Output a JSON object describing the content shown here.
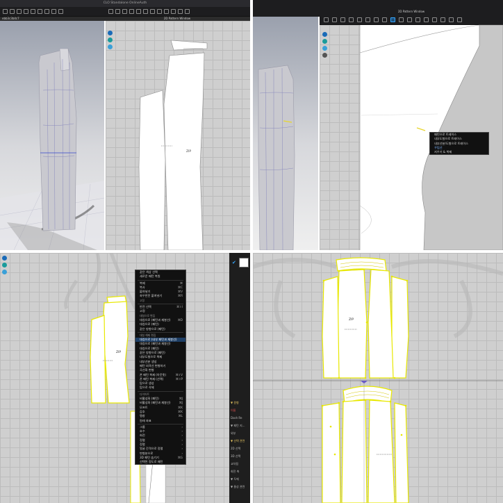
{
  "q1": {
    "window_title": "CLO Standalone OnlineAuth",
    "left_tab": "ebb3c3b4c7",
    "panel_2d_title": "2D Pattern Window",
    "zip_label": "ZIP"
  },
  "q2": {
    "panel_2d_title": "2D Pattern Window",
    "context_menu": [
      "패턴으로 트레이스",
      "내부도형으로 트레이스",
      "내부선분/도형으로 트레이스",
      "꾸밈선",
      "지우기 & 복제"
    ]
  },
  "q3": {
    "zip_label": "ZIP",
    "context_menu": [
      {
        "label": "같은 색상 선택",
        "sc": ""
      },
      {
        "label": "새로운 패턴 복원",
        "sc": ""
      },
      {
        "label": "",
        "sc": "",
        "sep": true
      },
      {
        "label": "복제",
        "sc": "⌘",
        "dis": false
      },
      {
        "label": "복사",
        "sc": "⌘C"
      },
      {
        "label": "붙여넣기",
        "sc": "⌘V"
      },
      {
        "label": "좌우반전 붙여넣기",
        "sc": "⌘R"
      },
      {
        "label": "고정",
        "sc": "",
        "sec": true
      },
      {
        "label": "",
        "sc": "",
        "sep": true
      },
      {
        "label": "반전 선택",
        "sc": "⌘⇧I"
      },
      {
        "label": "고정",
        "sc": ""
      },
      {
        "label": "대칭으로 편집",
        "sc": "",
        "sec": true
      },
      {
        "label": "대칭으로 (패턴과 재봉선)",
        "sc": "⌘D"
      },
      {
        "label": "대칭으로 (패턴)",
        "sc": ""
      },
      {
        "label": "같은 방향으로 (패턴)",
        "sc": ""
      },
      {
        "label": "",
        "sc": "",
        "sep": true
      },
      {
        "label": "대칭 해제 편집",
        "sc": "",
        "sec": true
      },
      {
        "label": "대칭으로 (내부 패턴과 재봉선)",
        "sc": "",
        "hl": true
      },
      {
        "label": "대칭으로 (패턴과 재봉선)",
        "sc": ""
      },
      {
        "label": "대칭으로 (패턴)",
        "sc": ""
      },
      {
        "label": "같은 방향으로 (패턴)",
        "sc": ""
      },
      {
        "label": "내부도형으로 복제",
        "sc": ""
      },
      {
        "label": "내부선분 생성",
        "sc": ""
      },
      {
        "label": "패턴 외곽선 변형하기",
        "sc": ""
      },
      {
        "label": "곡선화 변형",
        "sc": ""
      },
      {
        "label": "폰 패턴 복제 (아웃핏)",
        "sc": "⌘⇧V"
      },
      {
        "label": "폰 패턴 복제 (선택)",
        "sc": "⌘⇧P"
      },
      {
        "label": "탑으로 생성",
        "sc": ""
      },
      {
        "label": "탑으로 삭제",
        "sc": ""
      },
      {
        "label": "",
        "sc": "",
        "sep": true
      },
      {
        "label": "다이어트",
        "sc": "",
        "sec": true
      },
      {
        "label": "비활성화 (패턴)",
        "sc": "⌘J"
      },
      {
        "label": "비활성화 (패턴과 재봉선)",
        "sc": "⌘J"
      },
      {
        "label": "모프트",
        "sc": "⌘K"
      },
      {
        "label": "감추",
        "sc": "⌘K"
      },
      {
        "label": "팽창",
        "sc": "⌘L"
      },
      {
        "label": "원래 좌표",
        "sc": ""
      },
      {
        "label": "",
        "sc": "",
        "sep": true
      },
      {
        "label": "그룹",
        "sc": "›"
      },
      {
        "label": "호수",
        "sc": "›"
      },
      {
        "label": "회전",
        "sc": "›"
      },
      {
        "label": "정렬",
        "sc": "›"
      },
      {
        "label": "정렬",
        "sc": "›"
      },
      {
        "label": "얼굴 간격으로 정렬",
        "sc": "›"
      },
      {
        "label": "변형분으로",
        "sc": "›"
      },
      {
        "label": "3D 패턴 숨기기",
        "sc": "⌘G"
      },
      {
        "label": "선택된 정도로 패턴",
        "sc": ""
      }
    ],
    "right_panel": [
      {
        "label": "▼ 원형",
        "color": "#e0c060"
      },
      {
        "label": "이름",
        "color": "#e05050"
      },
      {
        "label": "Dash Re",
        "color": "#bbb"
      },
      {
        "label": "▼ 패턴 지...",
        "color": "#bbb"
      },
      {
        "label": "외부",
        "color": "#bbb"
      },
      {
        "label": "▼ 선택 관련",
        "color": "#e0c060"
      },
      {
        "label": "2D 선택",
        "color": "#bbb"
      },
      {
        "label": "3D 선택",
        "color": "#bbb"
      },
      {
        "label": "교차됨",
        "color": "#bbb"
      },
      {
        "label": "회전 축",
        "color": "#bbb"
      },
      {
        "label": "▼ 두께",
        "color": "#bbb"
      },
      {
        "label": "▼ 물성 관련",
        "color": "#bbb"
      }
    ]
  },
  "q4": {
    "zip_label": "ZIP"
  }
}
